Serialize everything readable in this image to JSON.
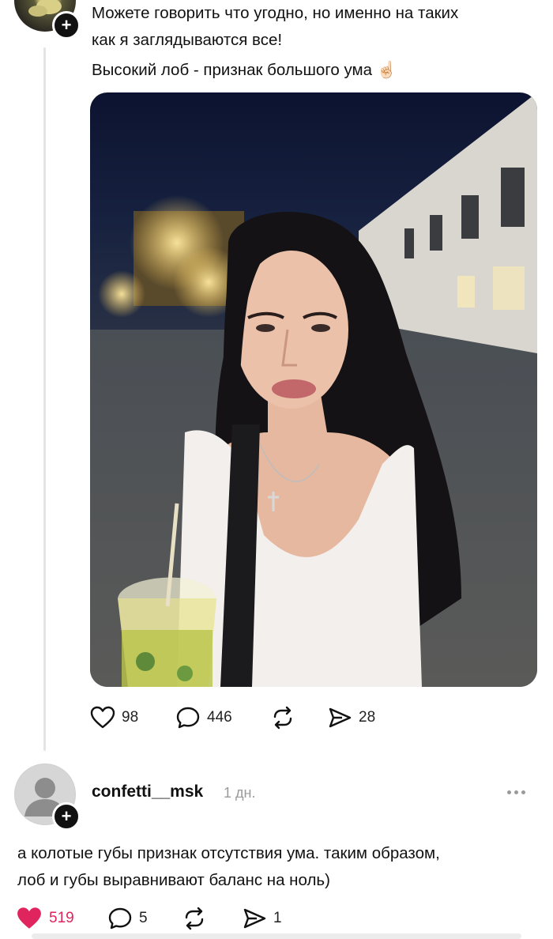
{
  "post": {
    "text_lines": [
      "Можете говорить что угодно, но именно на таких",
      "как я заглядываются все!",
      "Высокий лоб - признак большого ума ☝🏻"
    ],
    "stats": {
      "likes": "98",
      "comments": "446",
      "reposts": "",
      "shares": "28"
    }
  },
  "comment": {
    "username": "confetti__msk",
    "time": "1 дн.",
    "text_lines": [
      "а колотые губы признак отсутствия ума. таким образом,",
      "лоб и губы выравнивают баланс на ноль)"
    ],
    "stats": {
      "likes": "519",
      "comments": "5",
      "reposts": "",
      "shares": "1"
    }
  },
  "icons": {
    "avatar_plus": "plus-icon",
    "like": "heart-icon",
    "comment": "comment-bubble-icon",
    "repost": "repost-icon",
    "share": "send-icon",
    "more": "more-dots-icon"
  },
  "colors": {
    "like_active": "#e0245e",
    "text": "#111111",
    "muted": "#9a9a9a"
  }
}
